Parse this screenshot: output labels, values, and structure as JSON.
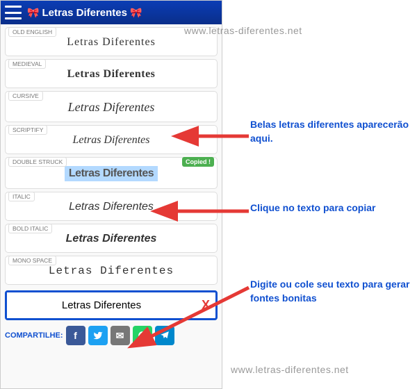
{
  "header": {
    "title": "Letras Diferentes",
    "bow": "🎀"
  },
  "fonts": [
    {
      "tag": "OLD ENGLISH",
      "text": "Letras Diferentes",
      "cls": "old-english"
    },
    {
      "tag": "MEDIEVAL",
      "text": "Letras Diferentes",
      "cls": "medieval"
    },
    {
      "tag": "CURSIVE",
      "text": "Letras Diferentes",
      "cls": "cursive"
    },
    {
      "tag": "SCRIPTIFY",
      "text": "Letras Diferentes",
      "cls": "scriptify"
    },
    {
      "tag": "DOUBLE STRUCK",
      "text": "Letras Diferentes",
      "cls": "double-struck",
      "copied": "Copied !"
    },
    {
      "tag": "ITALIC",
      "text": "Letras Diferentes",
      "cls": "italic"
    },
    {
      "tag": "BOLD ITALIC",
      "text": "Letras Diferentes",
      "cls": "bold-italic"
    },
    {
      "tag": "MONO SPACE",
      "text": "Letras Diferentes",
      "cls": "mono-space"
    }
  ],
  "input": {
    "value": "Letras Diferentes",
    "clear": "X"
  },
  "share": {
    "label": "COMPARTILHE:"
  },
  "annotations": {
    "a1": "Belas letras diferentes aparecerão aqui.",
    "a2": "Clique no texto para copiar",
    "a3": "Digite ou cole seu texto para gerar fontes bonitas"
  },
  "watermark": "www.letras-diferentes.net"
}
